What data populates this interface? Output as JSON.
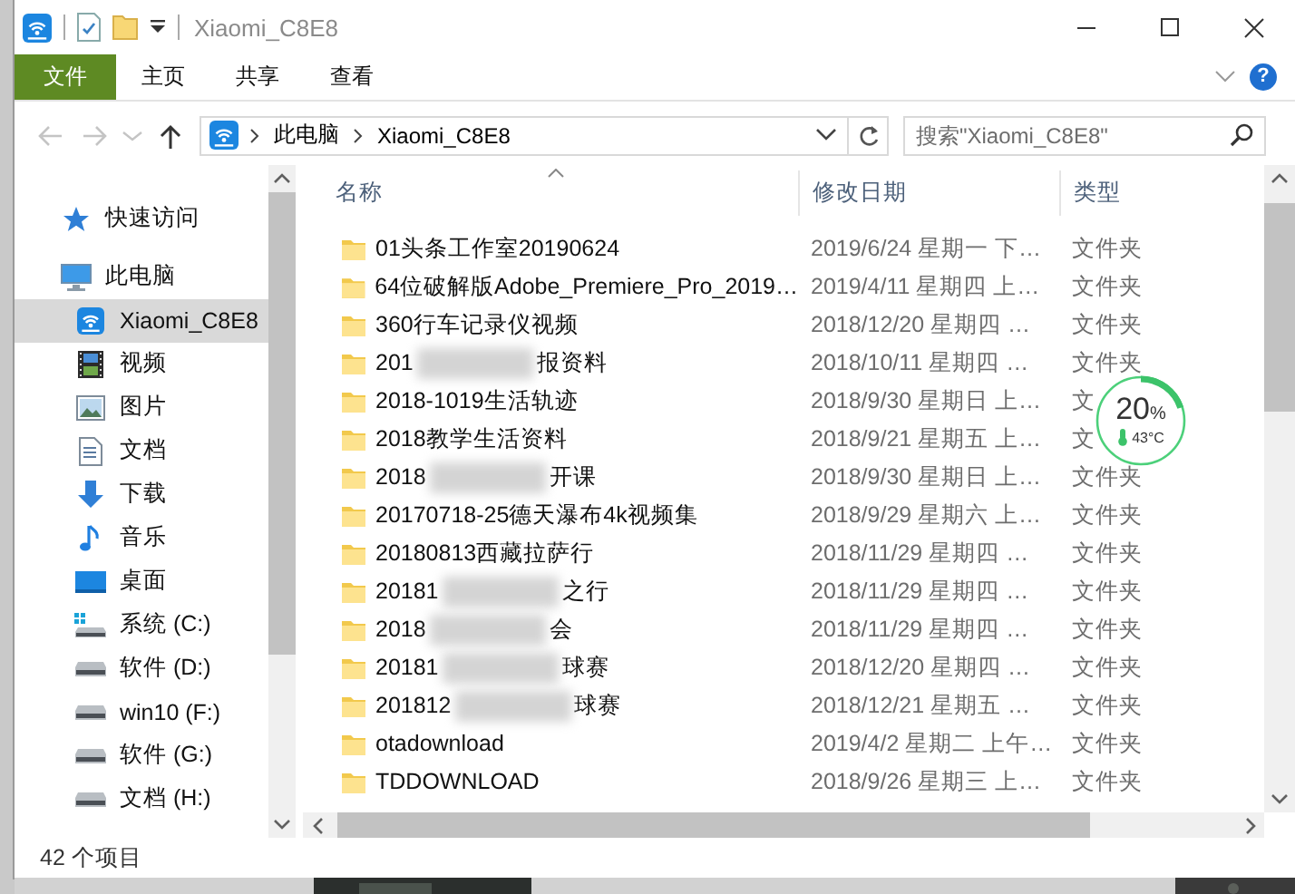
{
  "window": {
    "title": "Xiaomi_C8E8"
  },
  "ribbon": {
    "tabs": [
      {
        "label": "文件",
        "kind": "file-menu"
      },
      {
        "label": "主页",
        "kind": "tab"
      },
      {
        "label": "共享",
        "kind": "tab"
      },
      {
        "label": "查看",
        "kind": "tab"
      }
    ],
    "help": "?"
  },
  "address_bar": {
    "nav_buttons": [
      {
        "kind": "back",
        "disabled": true
      },
      {
        "kind": "forward",
        "disabled": true
      },
      {
        "kind": "recent",
        "disabled": true
      },
      {
        "kind": "up",
        "disabled": false
      }
    ],
    "path": [
      "此电脑",
      "Xiaomi_C8E8"
    ],
    "search": {
      "placeholder": "搜索\"Xiaomi_C8E8\""
    }
  },
  "navigation": [
    {
      "label": "快速访问",
      "kind": "quick-access",
      "selected": false
    },
    {
      "label": "此电脑",
      "kind": "computer",
      "selected": false,
      "children": [
        {
          "label": "Xiaomi_C8E8",
          "kind": "network-drive",
          "selected": true
        },
        {
          "label": "视频",
          "kind": "videos",
          "selected": false
        },
        {
          "label": "图片",
          "kind": "pictures",
          "selected": false
        },
        {
          "label": "文档",
          "kind": "documents",
          "selected": false
        },
        {
          "label": "下载",
          "kind": "downloads",
          "selected": false
        },
        {
          "label": "音乐",
          "kind": "music",
          "selected": false
        },
        {
          "label": "桌面",
          "kind": "desktop",
          "selected": false
        },
        {
          "label": "系统 (C:)",
          "kind": "system-drive",
          "selected": false
        },
        {
          "label": "软件 (D:)",
          "kind": "drive",
          "selected": false
        },
        {
          "label": "win10 (F:)",
          "kind": "drive",
          "selected": false
        },
        {
          "label": "软件 (G:)",
          "kind": "drive",
          "selected": false
        },
        {
          "label": "文档 (H:)",
          "kind": "drive",
          "selected": false
        }
      ]
    }
  ],
  "file_list": {
    "columns": [
      {
        "label": "名称",
        "sorted": true
      },
      {
        "label": "修改日期",
        "sorted": false
      },
      {
        "label": "类型",
        "sorted": false
      }
    ],
    "rows": [
      {
        "kind": "plain",
        "name": "01头条工作室20190624",
        "date": "2019/6/24 星期一 下…",
        "type": "文件夹"
      },
      {
        "kind": "plain",
        "name": "64位破解版Adobe_Premiere_Pro_2019…",
        "date": "2019/4/11 星期四 上…",
        "type": "文件夹"
      },
      {
        "kind": "plain",
        "name": "360行车记录仪视频",
        "date": "2018/12/20 星期四 …",
        "type": "文件夹"
      },
      {
        "kind": "redacted",
        "name_start": "201",
        "name_end": "报资料",
        "date": "2018/10/11 星期四 …",
        "type": "文件夹"
      },
      {
        "kind": "plain",
        "name": "2018-1019生活轨迹",
        "date": "2018/9/30 星期日 上…",
        "type": "文"
      },
      {
        "kind": "plain",
        "name": "2018教学生活资料",
        "date": "2018/9/21 星期五 上…",
        "type": "文"
      },
      {
        "kind": "redacted",
        "name_start": "2018",
        "name_end": "开课",
        "date": "2018/9/30 星期日 上…",
        "type": "文件夹"
      },
      {
        "kind": "plain",
        "name": "20170718-25德天瀑布4k视频集",
        "date": "2018/9/29 星期六 上…",
        "type": "文件夹"
      },
      {
        "kind": "plain",
        "name": "20180813西藏拉萨行",
        "date": "2018/11/29 星期四 …",
        "type": "文件夹"
      },
      {
        "kind": "redacted",
        "name_start": "20181",
        "name_end": "之行",
        "date": "2018/11/29 星期四 …",
        "type": "文件夹"
      },
      {
        "kind": "redacted",
        "name_start": "2018",
        "name_end": "会",
        "date": "2018/11/29 星期四 …",
        "type": "文件夹"
      },
      {
        "kind": "redacted",
        "name_start": "20181",
        "name_end": "球赛",
        "date": "2018/12/20 星期四 …",
        "type": "文件夹"
      },
      {
        "kind": "redacted",
        "name_start": "201812",
        "name_end": "球赛",
        "date": "2018/12/21 星期五 …",
        "type": "文件夹"
      },
      {
        "kind": "plain",
        "name": "otadownload",
        "date": "2019/4/2 星期二 上午…",
        "type": "文件夹"
      },
      {
        "kind": "plain",
        "name": "TDDOWNLOAD",
        "date": "2018/9/26 星期三 上…",
        "type": "文件夹"
      }
    ]
  },
  "widget": {
    "percent": "20",
    "unit": "%",
    "temperature": "43°C"
  },
  "status_bar": {
    "count": "42 个项目"
  }
}
